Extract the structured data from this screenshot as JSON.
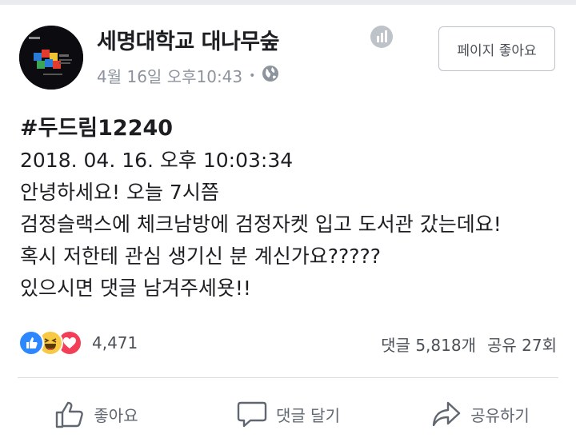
{
  "header": {
    "page_name": "세명대학교 대나무숲",
    "timestamp": "4월 16일 오후10:43",
    "separator": "•",
    "audience_icon": "globe-icon",
    "insights_icon": "bar-chart-icon",
    "like_page_label": "페이지 좋아요"
  },
  "post": {
    "hashtag": "#두드림12240",
    "lines": [
      "2018. 04. 16. 오후 10:03:34",
      "안녕하세요! 오늘 7시쯤",
      "검정슬랙스에 체크남방에 검정자켓 입고 도서관 갔는데요!",
      "혹시 저한테 관심 생기신 분 계신가요?????",
      "있으시면 댓글 남겨주세욧!!"
    ]
  },
  "stats": {
    "reactions": [
      "like-reaction-icon",
      "haha-reaction-icon",
      "love-reaction-icon"
    ],
    "reaction_count": "4,471",
    "comments": "댓글 5,818개",
    "shares": "공유 27회"
  },
  "actions": {
    "like": "좋아요",
    "comment": "댓글 달기",
    "share": "공유하기"
  },
  "colors": {
    "like_blue": "#2d88ff",
    "haha_yellow": "#f7c944",
    "love_red": "#f33e58",
    "muted_text": "#8d949e"
  }
}
